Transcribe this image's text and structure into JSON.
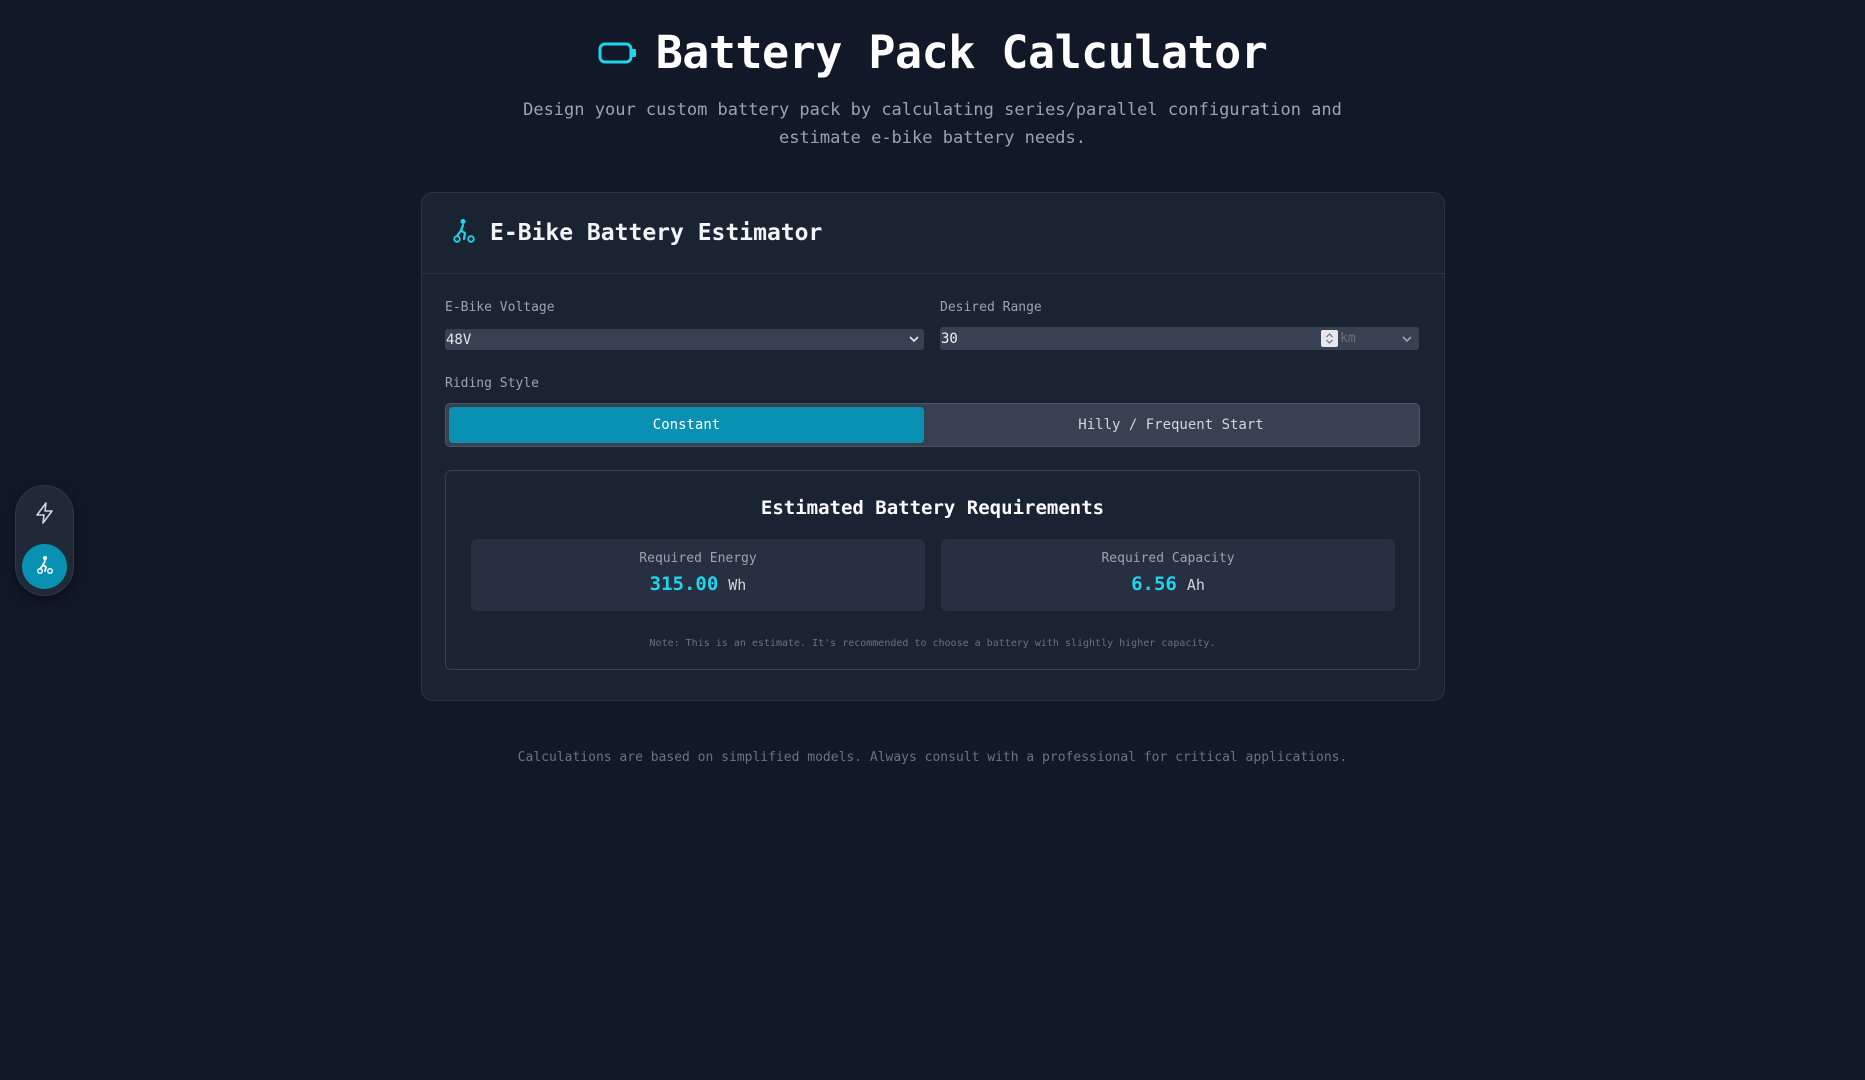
{
  "header": {
    "title": "Battery Pack Calculator",
    "subtitle_line1": "Design your custom battery pack by calculating series/parallel configuration and",
    "subtitle_line2": "estimate e-bike battery needs."
  },
  "side_nav": {
    "items": [
      {
        "icon": "bolt-icon",
        "active": false
      },
      {
        "icon": "bike-icon",
        "active": true
      }
    ]
  },
  "estimator": {
    "title": "E-Bike Battery Estimator",
    "voltage": {
      "label": "E-Bike Voltage",
      "value": "48V"
    },
    "range": {
      "label": "Desired Range",
      "value": "30",
      "unit": "km"
    },
    "riding_style": {
      "label": "Riding Style",
      "options": [
        "Constant",
        "Hilly / Frequent Start"
      ],
      "selected": "Constant"
    },
    "results": {
      "title": "Estimated Battery Requirements",
      "energy": {
        "label": "Required Energy",
        "value": "315.00",
        "unit": "Wh"
      },
      "capacity": {
        "label": "Required Capacity",
        "value": "6.56",
        "unit": "Ah"
      },
      "note": "Note: This is an estimate. It's recommended to choose a battery with slightly higher capacity."
    }
  },
  "footer": {
    "text": "Calculations are based on simplified models. Always consult with a professional for critical applications."
  },
  "colors": {
    "background": "#111827",
    "card": "#1a2332",
    "accent": "#0891b2",
    "accent_text": "#22d3ee"
  }
}
